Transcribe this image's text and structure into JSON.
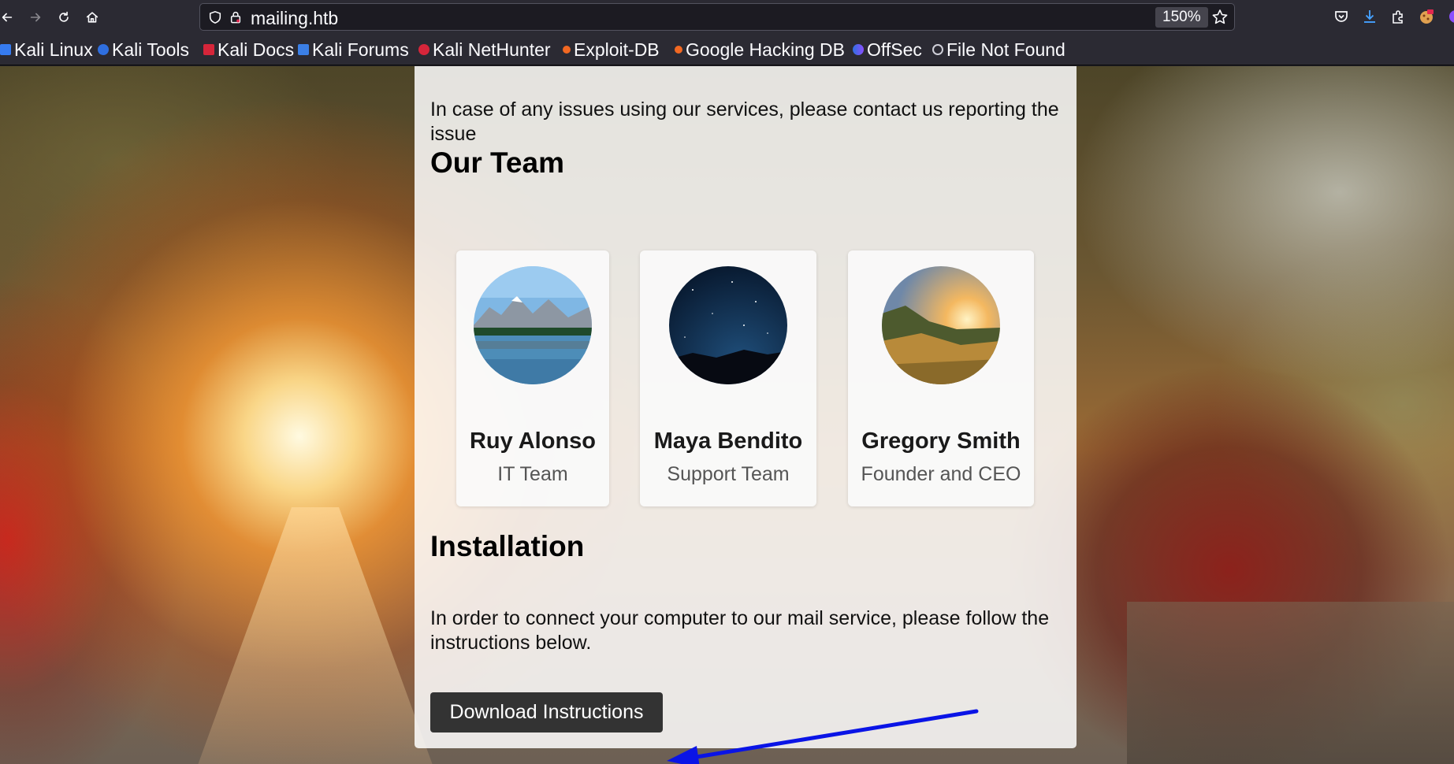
{
  "browser": {
    "url": "mailing.htb",
    "zoom": "150%",
    "bookmarks": [
      {
        "label": "Kali Linux",
        "color": "#367bf0"
      },
      {
        "label": "Kali Tools",
        "color": "#2f6fe0"
      },
      {
        "label": "Kali Docs",
        "color": "#d6253a"
      },
      {
        "label": "Kali Forums",
        "color": "#3b7fe6"
      },
      {
        "label": "Kali NetHunter",
        "color": "#d6253a"
      },
      {
        "label": "Exploit-DB",
        "color": "#f26822"
      },
      {
        "label": "Google Hacking DB",
        "color": "#f26822"
      },
      {
        "label": "OffSec",
        "color": "#6e4bd8"
      },
      {
        "label": "File Not Found",
        "color": "#cfcfd8"
      }
    ]
  },
  "page": {
    "contact_text": "In case of any issues using our services, please contact us reporting the issue",
    "team_heading": "Our Team",
    "team": [
      {
        "name": "Ruy Alonso",
        "role": "IT Team"
      },
      {
        "name": "Maya Bendito",
        "role": "Support Team"
      },
      {
        "name": "Gregory Smith",
        "role": "Founder and CEO"
      }
    ],
    "install_heading": "Installation",
    "install_text": "In order to connect your computer to our mail service, please follow the instructions below.",
    "download_button": "Download Instructions"
  },
  "colors": {
    "browser_chrome": "#2b2a33",
    "button_bg": "#333333",
    "annotation_arrow": "#0a14e6"
  }
}
